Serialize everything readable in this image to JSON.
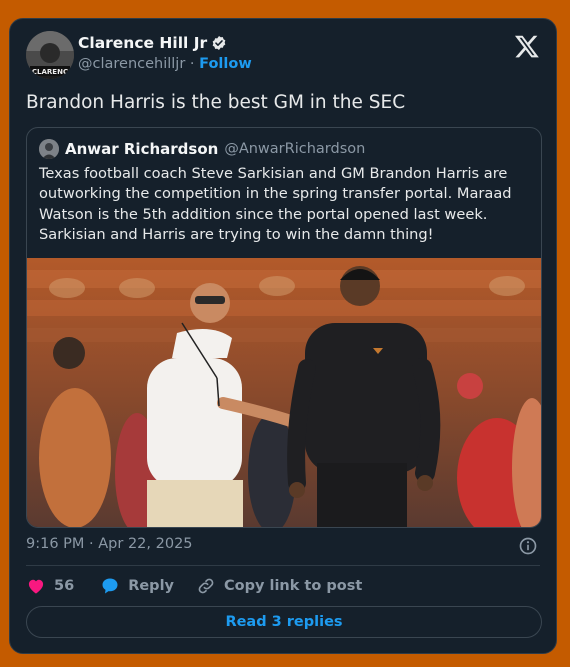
{
  "author": {
    "name": "Clarence Hill Jr",
    "handle": "@clarencehilljr",
    "separator": "·",
    "follow_label": "Follow",
    "avatar_caption": "CLARENC"
  },
  "tweet": {
    "text": "Brandon Harris is the best GM in the SEC"
  },
  "quoted": {
    "name": "Anwar Richardson",
    "handle": "@AnwarRichardson",
    "text": "Texas football coach Steve Sarkisian and GM Brandon Harris are outworking the competition in the spring transfer portal. Maraad Watson is the 5th addition since the portal opened last week. Sarkisian and Harris are trying to win the damn thing!"
  },
  "meta": {
    "timestamp": "9:16 PM · Apr 22, 2025"
  },
  "actions": {
    "like_count": "56",
    "reply_label": "Reply",
    "copy_label": "Copy link to post"
  },
  "replies_button": "Read 3 replies",
  "colors": {
    "background": "#c45b00",
    "card": "#15202b",
    "accent": "#1d9bf0",
    "like": "#f91880"
  },
  "icons": [
    "verified-badge-icon",
    "x-logo-icon",
    "info-icon",
    "heart-icon",
    "reply-bubble-icon",
    "link-icon"
  ]
}
